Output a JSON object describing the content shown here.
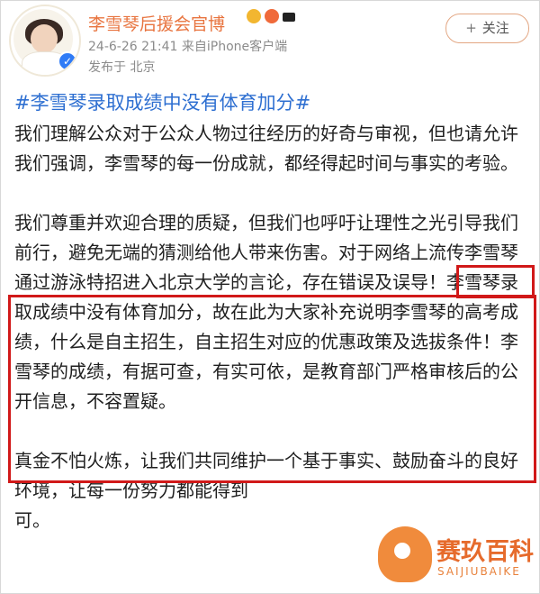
{
  "post": {
    "author": "李雪琴后援会官博",
    "datetime": "24-6-26 21:41",
    "source": "来自iPhone客户端",
    "location": "发布于 北京",
    "follow_label": "关注",
    "hashtag": "#李雪琴录取成绩中没有体育加分#",
    "paragraphs": [
      "我们理解公众对于公众人物过往经历的好奇与审视，但也请允许我们强调，李雪琴的每一份成就，都经得起时间与事实的考验。",
      "我们尊重并欢迎合理的质疑，但我们也呼吁让理性之光引导我们前行，避免无端的猜测给他人带来伤害。对于网络上流传李雪琴通过游泳特招进入北京大学的言论，存在错误及误导！李雪琴录取成绩中没有体育加分，故在此为大家补充说明李雪琴的高考成绩，什么是自主招生，自主招生对应的优惠政策及选拔条件！李雪琴的成绩，有据可查，有实可依，是教育部门严格审核后的公开信息，不容置疑。",
      "真金不怕火炼，让我们共同维护一个基于事实、鼓励奋斗的良好环境，让每一份努力都能得到"
    ],
    "tail_text": "可。"
  },
  "watermark": {
    "name_cn": "赛玖百科",
    "name_en": "SAIJIUBAIKE"
  },
  "colors": {
    "author": "#e8743f",
    "hashtag": "#2e6fd1",
    "highlight_box": "#d11919",
    "watermark": "#e66b2c"
  }
}
